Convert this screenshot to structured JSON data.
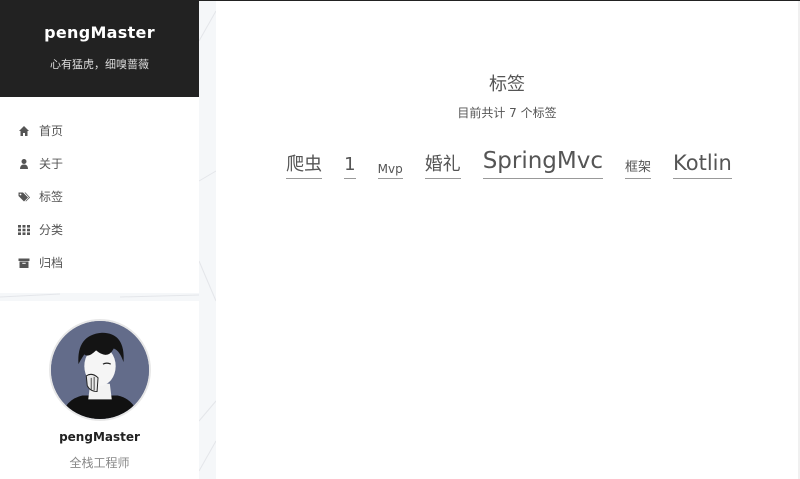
{
  "brand": {
    "title": "pengMaster",
    "subtitle": "心有猛虎，细嗅蔷薇"
  },
  "menu": {
    "items": [
      {
        "label": "首页",
        "icon": "home-icon"
      },
      {
        "label": "关于",
        "icon": "user-icon"
      },
      {
        "label": "标签",
        "icon": "tags-icon"
      },
      {
        "label": "分类",
        "icon": "grid-icon"
      },
      {
        "label": "归档",
        "icon": "archive-icon"
      }
    ]
  },
  "profile": {
    "name": "pengMaster",
    "description": "全栈工程师"
  },
  "main": {
    "title": "标签",
    "count_text": "目前共计 7 个标签",
    "tags": [
      {
        "label": "爬虫",
        "size": 18
      },
      {
        "label": "1",
        "size": 18
      },
      {
        "label": "Mvp",
        "size": 12
      },
      {
        "label": "婚礼",
        "size": 18
      },
      {
        "label": "SpringMvc",
        "size": 23
      },
      {
        "label": "框架",
        "size": 13
      },
      {
        "label": "Kotlin",
        "size": 21
      }
    ]
  },
  "colors": {
    "brand_bg": "#222222",
    "text": "#555555",
    "page_bg": "#f5f7f9"
  }
}
